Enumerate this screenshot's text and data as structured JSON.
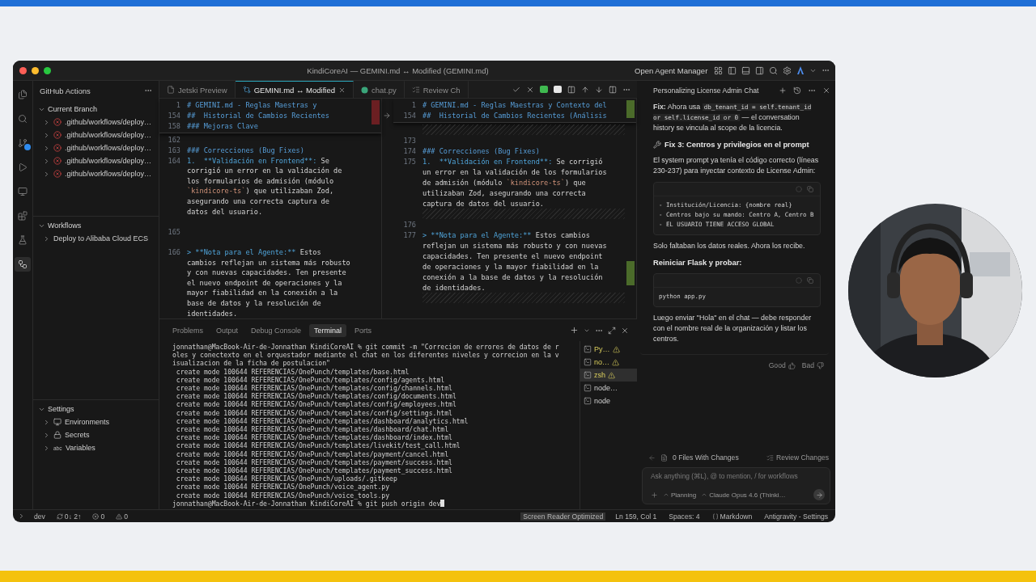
{
  "window": {
    "title": "KindiCoreAI — GEMINI.md ↔ Modified (GEMINI.md)",
    "agent_manager": "Open Agent Manager"
  },
  "activity_bar": [
    {
      "kind": "files",
      "selected": false
    },
    {
      "kind": "search",
      "selected": false
    },
    {
      "kind": "source-control",
      "selected": false
    },
    {
      "kind": "run",
      "selected": false
    },
    {
      "kind": "remote",
      "selected": false
    },
    {
      "kind": "extensions",
      "selected": false
    },
    {
      "kind": "testing",
      "selected": false
    },
    {
      "kind": "actions",
      "selected": true
    }
  ],
  "sidebar": {
    "title": "GitHub Actions",
    "sections": [
      {
        "title": "Current Branch",
        "expanded": true,
        "items": [
          {
            "label": ".github/workflows/deploy…",
            "kind": "failed",
            "expanded": false
          },
          {
            "label": ".github/workflows/deploy…",
            "kind": "failed",
            "expanded": false
          },
          {
            "label": ".github/workflows/deploy…",
            "kind": "failed",
            "expanded": false
          },
          {
            "label": ".github/workflows/deploy…",
            "kind": "failed",
            "expanded": false
          },
          {
            "label": ".github/workflows/deploy…",
            "kind": "failed",
            "expanded": false
          }
        ]
      },
      {
        "title": "Workflows",
        "expanded": true,
        "items": [
          {
            "label": "Deploy to Alibaba Cloud ECS",
            "kind": "plain",
            "expanded": false
          }
        ]
      },
      {
        "title": "Settings",
        "expanded": true,
        "items": [
          {
            "label": "Environments",
            "kind": "environment",
            "expanded": false
          },
          {
            "label": "Secrets",
            "kind": "secret",
            "expanded": false
          },
          {
            "label": "Variables",
            "kind": "variable",
            "glyph": "abc",
            "expanded": false
          }
        ]
      }
    ]
  },
  "editor": {
    "tabs": [
      {
        "label": "Jetski Preview",
        "kind": "preview",
        "selected": false
      },
      {
        "label": "GEMINI.md ↔ Modified",
        "kind": "diff",
        "selected": true
      },
      {
        "label": "chat.py",
        "kind": "python",
        "selected": false
      },
      {
        "label": "Review Ch",
        "kind": "review",
        "selected": false
      }
    ],
    "panes": [
      {
        "sticky": [
          {
            "kind": "line",
            "number": "1",
            "parts": [
              {
                "kind": "heading",
                "text": "# GEMINI.md - Reglas Maestras y"
              }
            ]
          },
          {
            "kind": "line",
            "number": "154",
            "parts": [
              {
                "kind": "heading",
                "text": "##  Historial de Cambios Recientes"
              }
            ]
          },
          {
            "kind": "line",
            "number": "158",
            "parts": [
              {
                "kind": "heading",
                "text": "### Mejoras Clave"
              }
            ]
          }
        ],
        "rows": [
          {
            "kind": "line",
            "number": "162"
          },
          {
            "kind": "line",
            "number": "163",
            "parts": [
              {
                "kind": "heading",
                "text": "### Correcciones (Bug Fixes)"
              }
            ]
          },
          {
            "kind": "line",
            "number": "164",
            "parts": [
              {
                "kind": "emphasis",
                "text": "1.  **Validación en Frontend**:"
              },
              {
                "kind": "plain",
                "text": " Se"
              }
            ]
          },
          {
            "kind": "wrap",
            "parts": [
              {
                "kind": "plain",
                "text": "corrigió un error en la validación de"
              }
            ]
          },
          {
            "kind": "wrap",
            "parts": [
              {
                "kind": "plain",
                "text": "los formularios de admisión (módulo"
              }
            ]
          },
          {
            "kind": "wrap",
            "parts": [
              {
                "kind": "code",
                "text": "`kindicore-ts`"
              },
              {
                "kind": "plain",
                "text": ") que utilizaban Zod,"
              }
            ]
          },
          {
            "kind": "wrap",
            "parts": [
              {
                "kind": "plain",
                "text": "asegurando una correcta captura de"
              }
            ]
          },
          {
            "kind": "wrap",
            "parts": [
              {
                "kind": "plain",
                "text": "datos del usuario."
              }
            ]
          },
          {
            "kind": "wrap"
          },
          {
            "kind": "line",
            "number": "165"
          },
          {
            "kind": "wrap"
          },
          {
            "kind": "line",
            "number": "166",
            "parts": [
              {
                "kind": "emphasis",
                "text": "> **Nota para el Agente:**"
              },
              {
                "kind": "plain",
                "text": " Estos"
              }
            ]
          },
          {
            "kind": "wrap",
            "parts": [
              {
                "kind": "plain",
                "text": "cambios reflejan un sistema más robusto"
              }
            ]
          },
          {
            "kind": "wrap",
            "parts": [
              {
                "kind": "plain",
                "text": "y con nuevas capacidades. Ten presente"
              }
            ]
          },
          {
            "kind": "wrap",
            "parts": [
              {
                "kind": "plain",
                "text": "el nuevo endpoint de operaciones y la"
              }
            ]
          },
          {
            "kind": "wrap",
            "parts": [
              {
                "kind": "plain",
                "text": "mayor fiabilidad en la conexión a la"
              }
            ]
          },
          {
            "kind": "wrap",
            "parts": [
              {
                "kind": "plain",
                "text": "base de datos y la resolución de"
              }
            ]
          },
          {
            "kind": "wrap",
            "parts": [
              {
                "kind": "plain",
                "text": "identidades."
              }
            ]
          }
        ]
      },
      {
        "sticky": [
          {
            "kind": "line",
            "number": "1",
            "parts": [
              {
                "kind": "heading",
                "text": "# GEMINI.md - Reglas Maestras y Contexto del"
              }
            ]
          },
          {
            "kind": "line",
            "number": "154",
            "parts": [
              {
                "kind": "heading",
                "text": "##  Historial de Cambios Recientes (Análisis"
              }
            ]
          }
        ],
        "rows": [
          {
            "kind": "filler"
          },
          {
            "kind": "line",
            "number": "173"
          },
          {
            "kind": "line",
            "number": "174",
            "parts": [
              {
                "kind": "heading",
                "text": "### Correcciones (Bug Fixes)"
              }
            ]
          },
          {
            "kind": "line",
            "number": "175",
            "parts": [
              {
                "kind": "emphasis",
                "text": "1.  **Validación en Frontend**:"
              },
              {
                "kind": "plain",
                "text": " Se corrigió"
              }
            ]
          },
          {
            "kind": "wrap",
            "parts": [
              {
                "kind": "plain",
                "text": "un error en la validación de los formularios"
              }
            ]
          },
          {
            "kind": "wrap",
            "parts": [
              {
                "kind": "plain",
                "text": "de admisión (módulo "
              },
              {
                "kind": "code",
                "text": "`kindicore-ts`"
              },
              {
                "kind": "plain",
                "text": ") que"
              }
            ]
          },
          {
            "kind": "wrap",
            "parts": [
              {
                "kind": "plain",
                "text": "utilizaban Zod, asegurando una correcta"
              }
            ]
          },
          {
            "kind": "wrap",
            "parts": [
              {
                "kind": "plain",
                "text": "captura de datos del usuario."
              }
            ]
          },
          {
            "kind": "filler"
          },
          {
            "kind": "line",
            "number": "176"
          },
          {
            "kind": "line",
            "number": "177",
            "parts": [
              {
                "kind": "emphasis",
                "text": "> **Nota para el Agente:**"
              },
              {
                "kind": "plain",
                "text": " Estos cambios"
              }
            ]
          },
          {
            "kind": "wrap",
            "parts": [
              {
                "kind": "plain",
                "text": "reflejan un sistema más robusto y con nuevas"
              }
            ]
          },
          {
            "kind": "wrap",
            "parts": [
              {
                "kind": "plain",
                "text": "capacidades. Ten presente el nuevo endpoint"
              }
            ]
          },
          {
            "kind": "wrap",
            "parts": [
              {
                "kind": "plain",
                "text": "de operaciones y la mayor fiabilidad en la"
              }
            ]
          },
          {
            "kind": "wrap",
            "parts": [
              {
                "kind": "plain",
                "text": "conexión a la base de datos y la resolución"
              }
            ]
          },
          {
            "kind": "wrap",
            "parts": [
              {
                "kind": "plain",
                "text": "de identidades."
              }
            ]
          },
          {
            "kind": "filler"
          }
        ]
      }
    ]
  },
  "panel": {
    "tabs": [
      {
        "label": "Problems",
        "selected": false
      },
      {
        "label": "Output",
        "selected": false
      },
      {
        "label": "Debug Console",
        "selected": false
      },
      {
        "label": "Terminal",
        "selected": true
      },
      {
        "label": "Ports",
        "selected": false
      }
    ],
    "terminal_lines": [
      "jonnathan@MacBook-Air-de-Jonnathan KindiCoreAI % git commit -m \"Correcion de errores de datos de r",
      "oles y conectexto en el orquestador mediante el chat en los diferentes niveles y correcion en la v",
      "isualizacion de la ficha de postulacion\"",
      " create mode 100644 REFERENCIAS/OnePunch/templates/base.html",
      " create mode 100644 REFERENCIAS/OnePunch/templates/config/agents.html",
      " create mode 100644 REFERENCIAS/OnePunch/templates/config/channels.html",
      " create mode 100644 REFERENCIAS/OnePunch/templates/config/documents.html",
      " create mode 100644 REFERENCIAS/OnePunch/templates/config/employees.html",
      " create mode 100644 REFERENCIAS/OnePunch/templates/config/settings.html",
      " create mode 100644 REFERENCIAS/OnePunch/templates/dashboard/analytics.html",
      " create mode 100644 REFERENCIAS/OnePunch/templates/dashboard/chat.html",
      " create mode 100644 REFERENCIAS/OnePunch/templates/dashboard/index.html",
      " create mode 100644 REFERENCIAS/OnePunch/templates/livekit/test_call.html",
      " create mode 100644 REFERENCIAS/OnePunch/templates/payment/cancel.html",
      " create mode 100644 REFERENCIAS/OnePunch/templates/payment/success.html",
      " create mode 100644 REFERENCIAS/OnePunch/templates/payment_success.html",
      " create mode 100644 REFERENCIAS/OnePunch/uploads/.gitkeep",
      " create mode 100644 REFERENCIAS/OnePunch/voice_agent.py",
      " create mode 100644 REFERENCIAS/OnePunch/voice_tools.py",
      "jonnathan@MacBook-Air-de-Jonnathan KindiCoreAI % git push origin dev"
    ],
    "sessions": [
      {
        "label": "Py…",
        "warning": true,
        "selected": false
      },
      {
        "label": "no…",
        "warning": true,
        "selected": false
      },
      {
        "label": "zsh",
        "warning": true,
        "selected": true
      },
      {
        "label": "node…",
        "warning": false,
        "selected": false
      },
      {
        "label": "node",
        "warning": false,
        "selected": false
      }
    ]
  },
  "chat": {
    "title": "Personalizing License Admin Chat",
    "blocks": [
      {
        "kind": "paragraph",
        "parts": [
          {
            "kind": "bold",
            "text": "Fix:"
          },
          {
            "kind": "text",
            "text": " Ahora usa "
          },
          {
            "kind": "code",
            "text": "db_tenant_id = self.tenant_id or self.license_id or 0"
          },
          {
            "kind": "text",
            "text": " — el conversation history se vincula al scope de la licencia."
          }
        ]
      },
      {
        "kind": "tool-heading",
        "text": "Fix 3: Centros y privilegios en el prompt"
      },
      {
        "kind": "paragraph",
        "parts": [
          {
            "kind": "text",
            "text": "El system prompt ya tenía el código correcto (líneas 230-237) para inyectar contexto de License Admin:"
          }
        ]
      },
      {
        "kind": "code",
        "lines": [
          "- Institución/Licencia: {nombre real}",
          "- Centros bajo su mando: Centro A, Centro B",
          "- EL USUARIO TIENE ACCESO GLOBAL"
        ]
      },
      {
        "kind": "paragraph",
        "parts": [
          {
            "kind": "text",
            "text": "Solo faltaban los datos reales. Ahora los recibe."
          }
        ]
      },
      {
        "kind": "heading",
        "text": "Reiniciar Flask y probar:"
      },
      {
        "kind": "code",
        "lines": [
          "python app.py"
        ]
      },
      {
        "kind": "paragraph",
        "parts": [
          {
            "kind": "text",
            "text": "Luego enviar \"Hola\" en el chat — debe responder con el nombre real de la organización y listar los centros."
          }
        ]
      }
    ],
    "feedback": [
      "Good",
      "Bad"
    ],
    "changes": "0 Files With Changes",
    "review": "Review Changes",
    "input": {
      "placeholder": "Ask anything (⌘L), @ to mention, / for workflows",
      "mode": "Planning",
      "model": "Claude Opus 4.6 (Thinki…"
    }
  },
  "status_bar": {
    "branch": "dev",
    "sync": "0↓ 2↑",
    "errors": "0",
    "warnings": "0",
    "items": [
      {
        "text": "Screen Reader Optimized",
        "kind": "highlight"
      },
      {
        "text": "Ln 159, Col 1",
        "kind": "plain"
      },
      {
        "text": "Spaces: 4",
        "kind": "plain"
      },
      {
        "text": "Markdown",
        "kind": "language"
      },
      {
        "text": "Antigravity - Settings",
        "kind": "plain"
      }
    ]
  }
}
